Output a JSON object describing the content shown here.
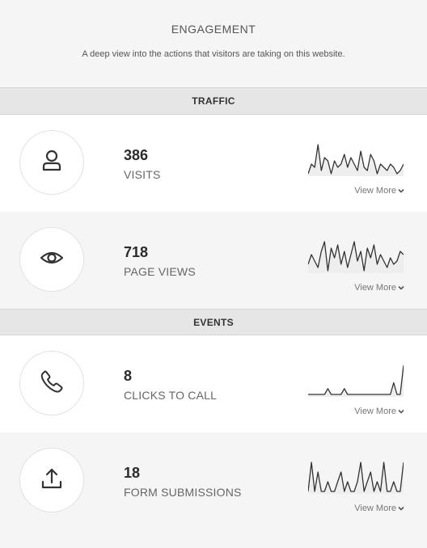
{
  "header": {
    "title": "ENGAGEMENT",
    "subtitle": "A deep view into the actions that visitors are taking on this website."
  },
  "sections": [
    {
      "title": "TRAFFIC",
      "metrics": [
        {
          "icon": "user-icon",
          "value": "386",
          "label": "VISITS",
          "view_more": "View More",
          "trend": [
            3,
            6,
            5,
            12,
            4,
            8,
            7,
            3,
            7,
            5,
            6,
            9,
            5,
            8,
            6,
            4,
            10,
            5,
            4,
            9,
            7,
            3,
            6,
            5,
            4,
            6,
            5,
            3,
            4,
            6
          ]
        },
        {
          "icon": "eye-icon",
          "value": "718",
          "label": "PAGE VIEWS",
          "view_more": "View More",
          "trend": [
            5,
            8,
            6,
            4,
            9,
            12,
            3,
            10,
            7,
            11,
            5,
            9,
            4,
            8,
            12,
            6,
            9,
            3,
            10,
            7,
            11,
            5,
            8,
            6,
            4,
            7,
            5,
            6,
            9,
            8
          ]
        }
      ]
    },
    {
      "title": "EVENTS",
      "metrics": [
        {
          "icon": "phone-icon",
          "value": "8",
          "label": "CLICKS TO CALL",
          "view_more": "View More",
          "trend": [
            0,
            0,
            0,
            0,
            0,
            0,
            1,
            0,
            0,
            0,
            0,
            1,
            0,
            0,
            0,
            0,
            0,
            0,
            0,
            0,
            0,
            0,
            0,
            0,
            0,
            0,
            2,
            0,
            0,
            5
          ]
        },
        {
          "icon": "upload-icon",
          "value": "18",
          "label": "FORM SUBMISSIONS",
          "view_more": "View More",
          "trend": [
            0,
            3,
            0,
            2,
            0,
            0,
            1,
            0,
            0,
            1,
            2,
            0,
            1,
            0,
            0,
            1,
            3,
            0,
            1,
            2,
            0,
            1,
            0,
            3,
            0,
            0,
            1,
            0,
            0,
            3
          ]
        }
      ]
    }
  ]
}
